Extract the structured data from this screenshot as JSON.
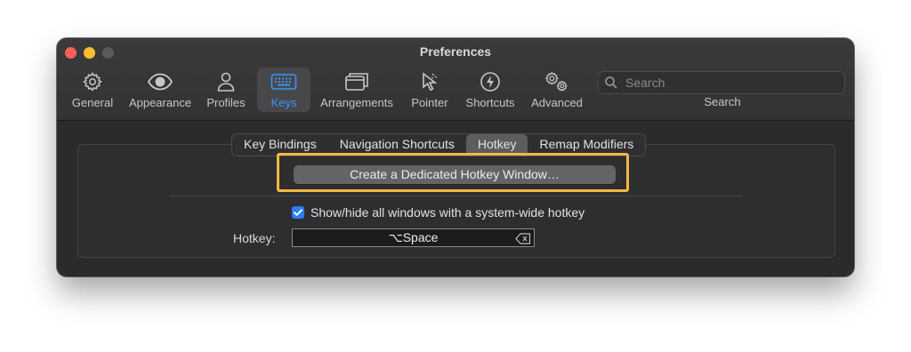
{
  "window": {
    "title": "Preferences"
  },
  "toolbar": {
    "items": [
      {
        "label": "General",
        "icon": "gear-icon"
      },
      {
        "label": "Appearance",
        "icon": "eye-icon"
      },
      {
        "label": "Profiles",
        "icon": "person-icon"
      },
      {
        "label": "Keys",
        "icon": "keyboard-icon",
        "active": true
      },
      {
        "label": "Arrangements",
        "icon": "windows-icon"
      },
      {
        "label": "Pointer",
        "icon": "cursor-icon"
      },
      {
        "label": "Shortcuts",
        "icon": "bolt-icon"
      },
      {
        "label": "Advanced",
        "icon": "gears-icon"
      }
    ],
    "search_placeholder": "Search",
    "search_label": "Search"
  },
  "keys": {
    "tabs": [
      "Key Bindings",
      "Navigation Shortcuts",
      "Hotkey",
      "Remap Modifiers"
    ],
    "selected_tab": "Hotkey",
    "create_button": "Create a Dedicated Hotkey Window…",
    "checkbox_label": "Show/hide all windows with a system-wide hotkey",
    "checkbox_checked": true,
    "hotkey_label": "Hotkey:",
    "hotkey_value": "⌥Space"
  },
  "colors": {
    "accent": "#3a92ff",
    "highlight_outline": "#f4b844",
    "close": "#fe5f57",
    "minimize": "#febc2e"
  }
}
